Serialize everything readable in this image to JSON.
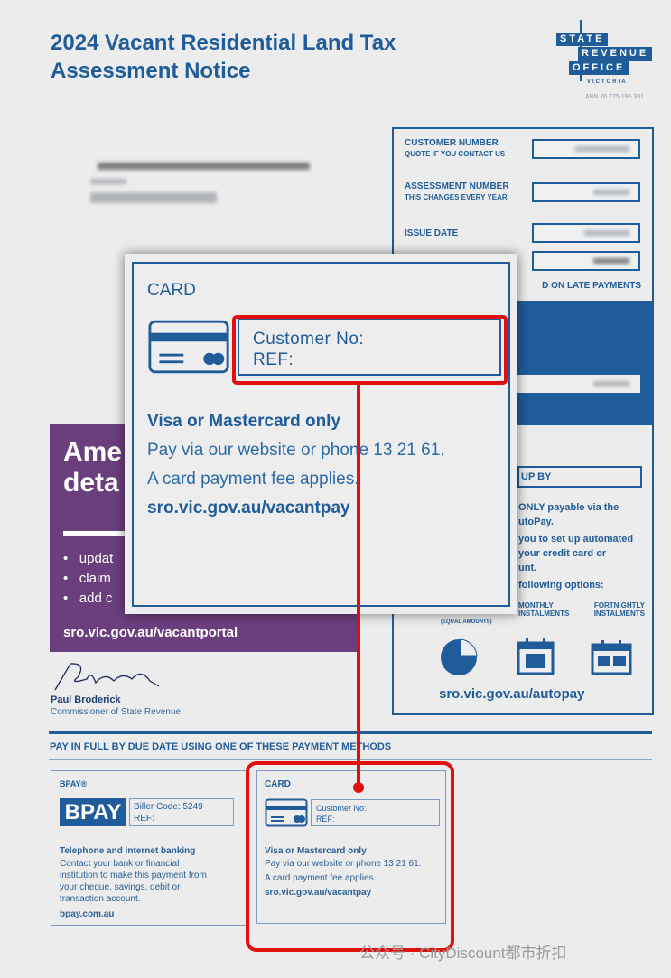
{
  "header": {
    "title_line1": "2024 Vacant Residential Land Tax",
    "title_line2": "Assessment Notice"
  },
  "logo": {
    "line1": "STATE",
    "line2": "REVENUE",
    "line3": "OFFICE",
    "line4": "VICTORIA",
    "abn": "ABN 76 775 195 331"
  },
  "info": {
    "customer_number": "CUSTOMER NUMBER",
    "customer_hint": "QUOTE IF YOU CONTACT US",
    "assessment_number": "ASSESSMENT NUMBER",
    "assessment_hint": "THIS CHANGES EVERY YEAR",
    "issue_date": "ISSUE DATE",
    "late": "D ON LATE PAYMENTS"
  },
  "autopay": {
    "setup_by": "UP BY",
    "line1": "ONLY payable via the",
    "line2": "utoPay.",
    "line3": "you to set up automated",
    "line4": "your credit card or",
    "line5": "unt.",
    "line6": "following options:",
    "opt1_note": "(EQUAL AMOUNTS)",
    "opt2": "MONTHLY INSTALMENTS",
    "opt3": "FORTNIGHTLY INSTALMENTS",
    "link": "sro.vic.gov.au/autopay"
  },
  "purple": {
    "h1": "Ame",
    "h2": "deta",
    "b1": "updat",
    "b2": "claim",
    "b3": "add c",
    "link": "sro.vic.gov.au/vacantportal"
  },
  "signature": {
    "name": "Paul Broderick",
    "role": "Commissioner of State Revenue"
  },
  "payment": {
    "heading": "PAY IN FULL BY DUE DATE USING ONE OF THESE PAYMENT METHODS",
    "bpay": {
      "title": "BPAY®",
      "logo": "BPAY",
      "biller": "Biller Code: 5249",
      "ref": "REF:",
      "h": "Telephone and internet banking",
      "body": "Contact your bank or financial institution to make this payment from your cheque, savings, debit or transaction account.",
      "link": "bpay.com.au"
    },
    "card": {
      "title": "CARD",
      "customer": "Customer No:",
      "ref": "REF:",
      "h": "Visa or Mastercard only",
      "l1": "Pay via our website or phone 13 21 61.",
      "l2": "A card payment fee applies.",
      "link": "sro.vic.gov.au/vacantpay"
    }
  },
  "popup": {
    "title": "CARD",
    "customer": "Customer No:",
    "ref": "REF:",
    "h": "Visa or Mastercard only",
    "l1": "Pay via our website or phone 13 21 61.",
    "l2": "A card payment fee applies.",
    "link": "sro.vic.gov.au/vacantpay"
  },
  "watermark": "公众号 · CityDiscount都市折扣",
  "colors": {
    "brand": "#1f5c99",
    "purple": "#6b3f7e",
    "highlight": "#e01010"
  }
}
